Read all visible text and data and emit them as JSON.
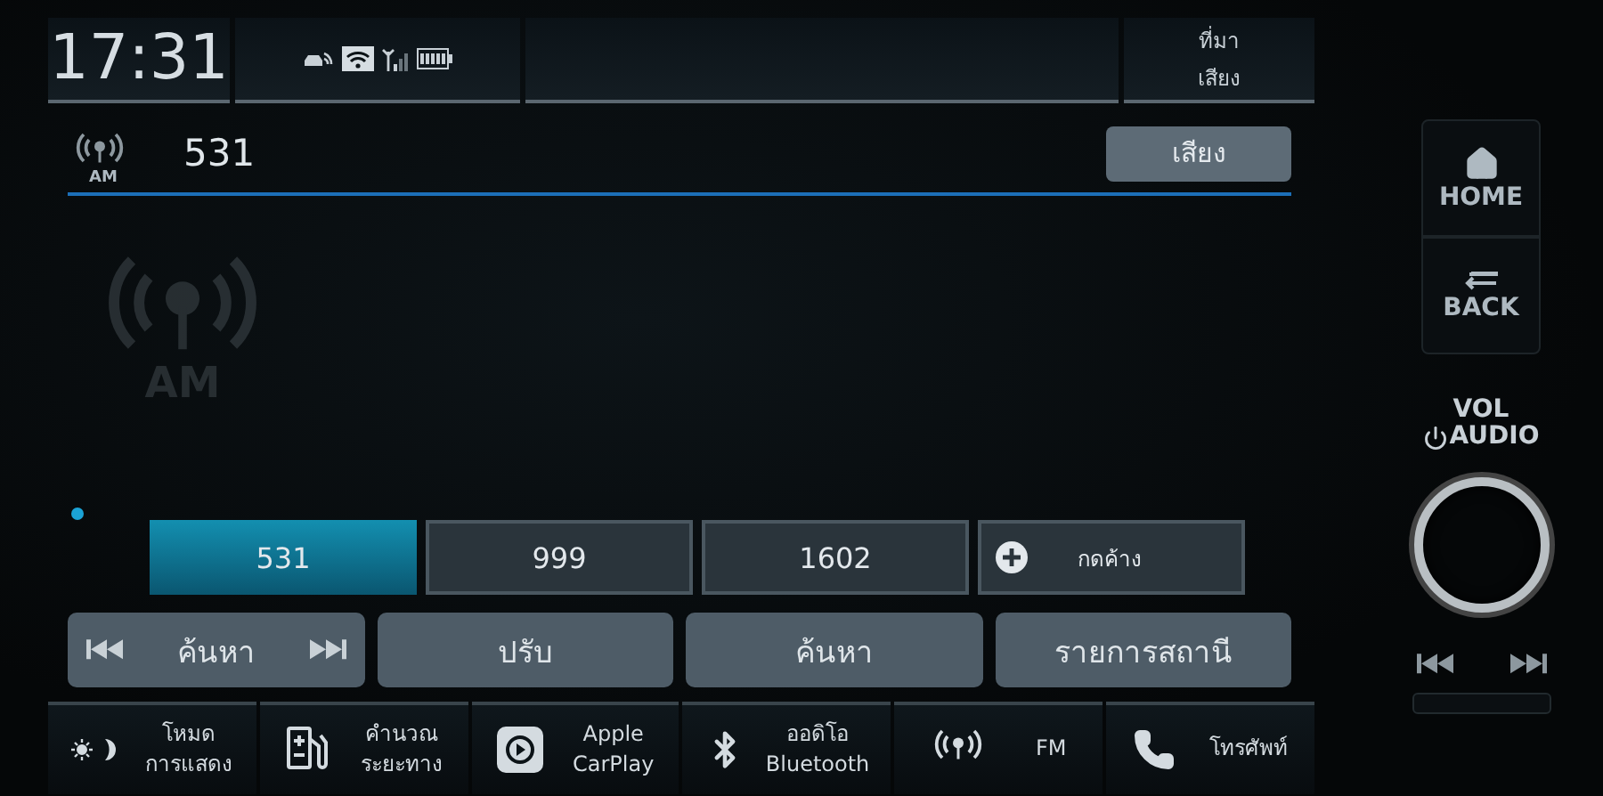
{
  "status_bar": {
    "time": "17:31",
    "source_button": [
      "ที่มา",
      "เสียง"
    ]
  },
  "station": {
    "band": "AM",
    "frequency": "531",
    "sound_button": "เสียง",
    "logo_band": "AM"
  },
  "presets": [
    {
      "label": "531",
      "selected": true
    },
    {
      "label": "999",
      "selected": false
    },
    {
      "label": "1602",
      "selected": false
    }
  ],
  "add_preset": {
    "label": "กดค้าง"
  },
  "controls": [
    {
      "kind": "seek",
      "label": "ค้นหา"
    },
    {
      "kind": "plain",
      "label": "ปรับ"
    },
    {
      "kind": "plain",
      "label": "ค้นหา"
    },
    {
      "kind": "plain",
      "label": "รายการสถานี"
    }
  ],
  "shortcuts": [
    {
      "kind": "display",
      "lines": [
        "โหมด",
        "การแสดง"
      ]
    },
    {
      "kind": "fuel",
      "lines": [
        "คำนวณ",
        "ระยะทาง"
      ]
    },
    {
      "kind": "carplay",
      "lines": [
        "Apple",
        "CarPlay"
      ]
    },
    {
      "kind": "bluetooth",
      "lines": [
        "ออดิโอ",
        "Bluetooth"
      ]
    },
    {
      "kind": "radio",
      "lines": [
        "FM"
      ]
    },
    {
      "kind": "phone",
      "lines": [
        "โทรศัพท์"
      ]
    }
  ],
  "hardware": {
    "home": "HOME",
    "back": "BACK",
    "vol": "VOL",
    "audio": "AUDIO"
  }
}
